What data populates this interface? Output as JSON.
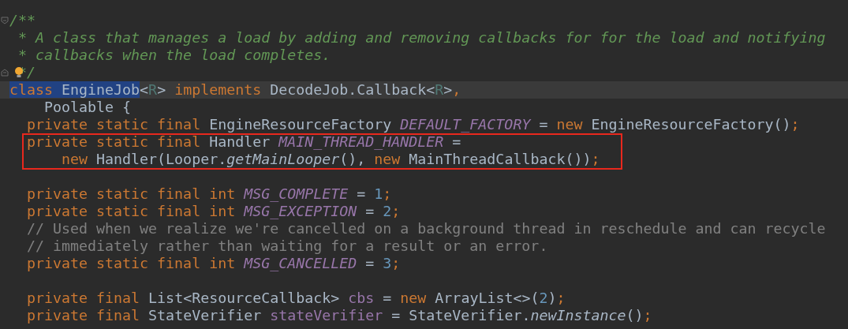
{
  "editor": {
    "lines": [
      {
        "fold_start": true,
        "fold_end": false,
        "current": false,
        "boxed": false,
        "bulb": false,
        "tokens": [
          {
            "text": "/**",
            "kind": "doc"
          }
        ]
      },
      {
        "current": false,
        "boxed": false,
        "bulb": false,
        "tokens": [
          {
            "text": " * A class that manages a load by adding and removing callbacks for for the load and notifying",
            "kind": "doc"
          }
        ]
      },
      {
        "current": false,
        "boxed": false,
        "bulb": false,
        "tokens": [
          {
            "text": " * callbacks when the load completes.",
            "kind": "doc"
          }
        ]
      },
      {
        "fold_start": false,
        "fold_end": true,
        "current": false,
        "boxed": false,
        "bulb": true,
        "tokens": [
          {
            "text": " */",
            "kind": "doc"
          }
        ]
      },
      {
        "current": true,
        "boxed": false,
        "bulb": false,
        "tokens": [
          {
            "text": "class",
            "kind": "keyword",
            "selected": true
          },
          {
            "text": " EngineJob",
            "kind": "plain",
            "selected": true
          },
          {
            "text": "<",
            "kind": "plain",
            "selected": false
          },
          {
            "text": "R",
            "kind": "typeparam",
            "selected": false
          },
          {
            "text": "> ",
            "kind": "plain",
            "selected": false
          },
          {
            "text": "implements",
            "kind": "keyword",
            "selected": false
          },
          {
            "text": " DecodeJob.Callback<",
            "kind": "plain",
            "selected": false
          },
          {
            "text": "R",
            "kind": "typeparam",
            "selected": false
          },
          {
            "text": ">",
            "kind": "plain",
            "selected": false
          },
          {
            "text": ",",
            "kind": "keyword",
            "selected": false
          }
        ]
      },
      {
        "current": false,
        "boxed": false,
        "bulb": false,
        "tokens": [
          {
            "text": "    Poolable {",
            "kind": "plain"
          }
        ]
      },
      {
        "current": false,
        "boxed": false,
        "bulb": false,
        "tokens": [
          {
            "text": "  private static final ",
            "kind": "keyword"
          },
          {
            "text": "EngineResourceFactory ",
            "kind": "plain"
          },
          {
            "text": "DEFAULT_FACTORY",
            "kind": "constant"
          },
          {
            "text": " = ",
            "kind": "plain"
          },
          {
            "text": "new ",
            "kind": "keyword"
          },
          {
            "text": "EngineResourceFactory()",
            "kind": "plain"
          },
          {
            "text": ";",
            "kind": "keyword"
          }
        ]
      },
      {
        "current": false,
        "boxed": true,
        "bulb": false,
        "tokens": [
          {
            "text": "  private static final ",
            "kind": "keyword"
          },
          {
            "text": "Handler ",
            "kind": "plain"
          },
          {
            "text": "MAIN_THREAD_HANDLER",
            "kind": "constant"
          },
          {
            "text": " =",
            "kind": "plain"
          }
        ]
      },
      {
        "current": false,
        "boxed": true,
        "bulb": false,
        "tokens": [
          {
            "text": "      new ",
            "kind": "keyword"
          },
          {
            "text": "Handler(Looper.",
            "kind": "plain"
          },
          {
            "text": "getMainLooper",
            "kind": "method"
          },
          {
            "text": "(), ",
            "kind": "plain"
          },
          {
            "text": "new ",
            "kind": "keyword"
          },
          {
            "text": "MainThreadCallback())",
            "kind": "plain"
          },
          {
            "text": ";",
            "kind": "keyword"
          }
        ]
      },
      {
        "current": false,
        "boxed": false,
        "bulb": false
      },
      {
        "current": false,
        "boxed": false,
        "bulb": false,
        "tokens": [
          {
            "text": "  private static final int ",
            "kind": "keyword"
          },
          {
            "text": "MSG_COMPLETE",
            "kind": "constant"
          },
          {
            "text": " = ",
            "kind": "plain"
          },
          {
            "text": "1",
            "kind": "number"
          },
          {
            "text": ";",
            "kind": "keyword"
          }
        ]
      },
      {
        "current": false,
        "boxed": false,
        "bulb": false,
        "tokens": [
          {
            "text": "  private static final int ",
            "kind": "keyword"
          },
          {
            "text": "MSG_EXCEPTION",
            "kind": "constant"
          },
          {
            "text": " = ",
            "kind": "plain"
          },
          {
            "text": "2",
            "kind": "number"
          },
          {
            "text": ";",
            "kind": "keyword"
          }
        ]
      },
      {
        "current": false,
        "boxed": false,
        "bulb": false,
        "tokens": [
          {
            "text": "  // Used when we realize we're cancelled on a background thread in reschedule and can recycle",
            "kind": "comment"
          }
        ]
      },
      {
        "current": false,
        "boxed": false,
        "bulb": false,
        "tokens": [
          {
            "text": "  // immediately rather than waiting for a result or an error.",
            "kind": "comment"
          }
        ]
      },
      {
        "current": false,
        "boxed": false,
        "bulb": false,
        "tokens": [
          {
            "text": "  private static final int ",
            "kind": "keyword"
          },
          {
            "text": "MSG_CANCELLED",
            "kind": "constant"
          },
          {
            "text": " = ",
            "kind": "plain"
          },
          {
            "text": "3",
            "kind": "number"
          },
          {
            "text": ";",
            "kind": "keyword"
          }
        ]
      },
      {
        "current": false,
        "boxed": false,
        "bulb": false
      },
      {
        "current": false,
        "boxed": false,
        "bulb": false,
        "tokens": [
          {
            "text": "  private final ",
            "kind": "keyword"
          },
          {
            "text": "List<ResourceCallback> ",
            "kind": "plain"
          },
          {
            "text": "cbs",
            "kind": "field"
          },
          {
            "text": " = ",
            "kind": "plain"
          },
          {
            "text": "new ",
            "kind": "keyword"
          },
          {
            "text": "ArrayList<>(",
            "kind": "plain"
          },
          {
            "text": "2",
            "kind": "number"
          },
          {
            "text": ")",
            "kind": "plain"
          },
          {
            "text": ";",
            "kind": "keyword"
          }
        ]
      },
      {
        "current": false,
        "boxed": false,
        "bulb": false,
        "tokens": [
          {
            "text": "  private final ",
            "kind": "keyword"
          },
          {
            "text": "StateVerifier ",
            "kind": "plain"
          },
          {
            "text": "stateVerifier",
            "kind": "field"
          },
          {
            "text": " = StateVerifier.",
            "kind": "plain"
          },
          {
            "text": "newInstance",
            "kind": "method"
          },
          {
            "text": "()",
            "kind": "plain"
          },
          {
            "text": ";",
            "kind": "keyword"
          }
        ]
      }
    ]
  }
}
